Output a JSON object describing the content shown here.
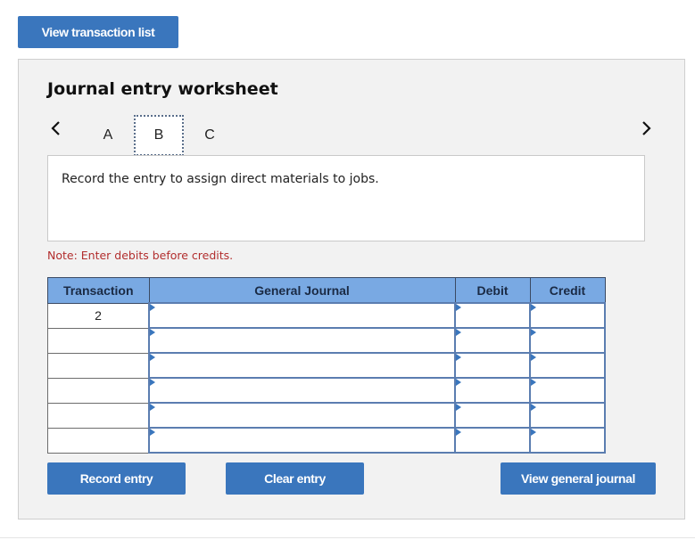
{
  "top_button": "View transaction list",
  "worksheet": {
    "title": "Journal entry worksheet",
    "tabs": [
      {
        "label": "A",
        "active": false
      },
      {
        "label": "B",
        "active": true
      },
      {
        "label": "C",
        "active": false
      }
    ],
    "prev_icon": "chevron-left-icon",
    "next_icon": "chevron-right-icon",
    "prompt": "Record the entry to assign direct materials to jobs.",
    "note": "Note: Enter debits before credits.",
    "table": {
      "headers": [
        "Transaction",
        "General Journal",
        "Debit",
        "Credit"
      ],
      "rows": [
        {
          "transaction": "2",
          "account": "",
          "debit": "",
          "credit": ""
        },
        {
          "transaction": "",
          "account": "",
          "debit": "",
          "credit": ""
        },
        {
          "transaction": "",
          "account": "",
          "debit": "",
          "credit": ""
        },
        {
          "transaction": "",
          "account": "",
          "debit": "",
          "credit": ""
        },
        {
          "transaction": "",
          "account": "",
          "debit": "",
          "credit": ""
        },
        {
          "transaction": "",
          "account": "",
          "debit": "",
          "credit": ""
        }
      ]
    },
    "buttons": {
      "record": "Record entry",
      "clear": "Clear entry",
      "view_journal": "View general journal"
    }
  },
  "colors": {
    "button": "#3a76bd",
    "header": "#79a9e3",
    "note": "#b22e2e"
  }
}
